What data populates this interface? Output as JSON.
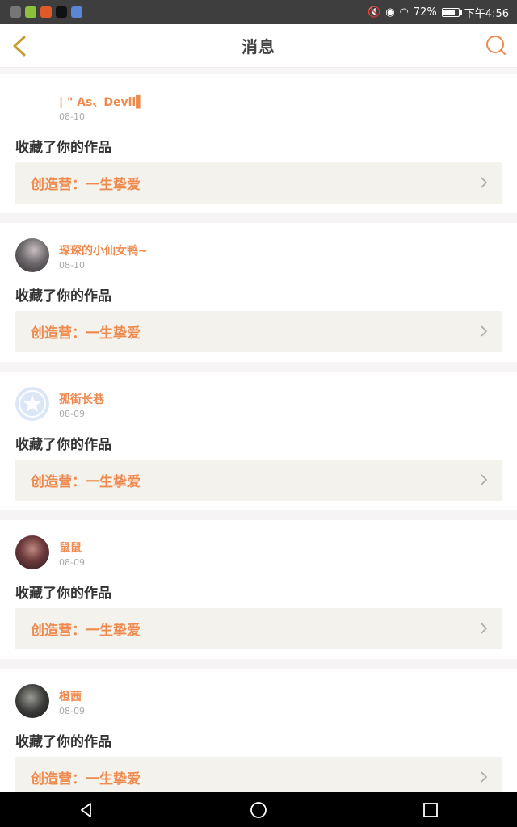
{
  "status": {
    "battery": "72%",
    "time": "下午4:56"
  },
  "header": {
    "title": "消息"
  },
  "notifications": [
    {
      "username": "| \" As、Devil▌",
      "date": "08-10",
      "action": "收藏了你的作品",
      "work": "创造营：一生挚爱",
      "avatar": "none"
    },
    {
      "username": "琛琛的小仙女鸭~",
      "date": "08-10",
      "action": "收藏了你的作品",
      "work": "创造营：一生挚爱",
      "avatar": "dark"
    },
    {
      "username": "孤街长巷",
      "date": "08-09",
      "action": "收藏了你的作品",
      "work": "创造营：一生挚爱",
      "avatar": "default"
    },
    {
      "username": "鼠鼠",
      "date": "08-09",
      "action": "收藏了你的作品",
      "work": "创造营：一生挚爱",
      "avatar": "purple"
    },
    {
      "username": "橙茜",
      "date": "08-09",
      "action": "收藏了你的作品",
      "work": "创造营：一生挚爱",
      "avatar": "dark"
    }
  ],
  "colors": {
    "accent": "#ef8a4f",
    "navIcon": "#c79a2c"
  }
}
